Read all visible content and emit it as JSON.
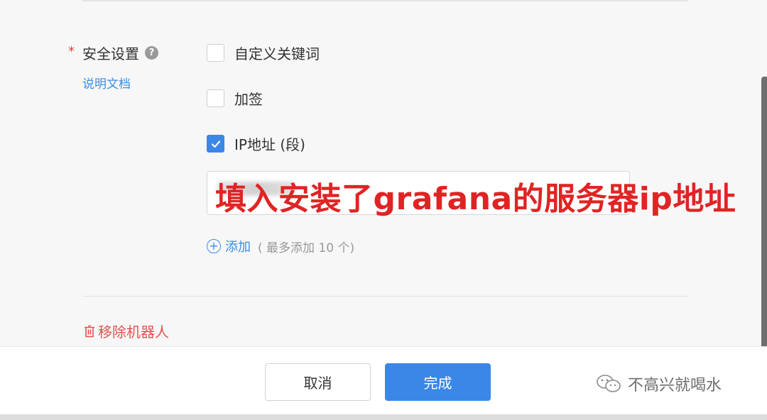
{
  "security": {
    "label": "安全设置",
    "required_mark": "*",
    "docs_link": "说明文档",
    "options": [
      {
        "label": "自定义关键词",
        "checked": false
      },
      {
        "label": "加签",
        "checked": false
      },
      {
        "label": "IP地址 (段)",
        "checked": true
      }
    ],
    "ip_annotation": "填入安装了grafana的服务器ip地址",
    "add_label": "添加",
    "add_hint": "( 最多添加 10 个)"
  },
  "remove_robot_label": "移除机器人",
  "footer": {
    "cancel_label": "取消",
    "done_label": "完成",
    "watermark": "不高兴就喝水"
  },
  "colors": {
    "accent": "#3b87e8",
    "danger": "#e55151",
    "annotation": "#e02424"
  },
  "icons": [
    "help-icon",
    "check-icon",
    "add-circle-icon",
    "trash-icon",
    "wechat-icon"
  ]
}
